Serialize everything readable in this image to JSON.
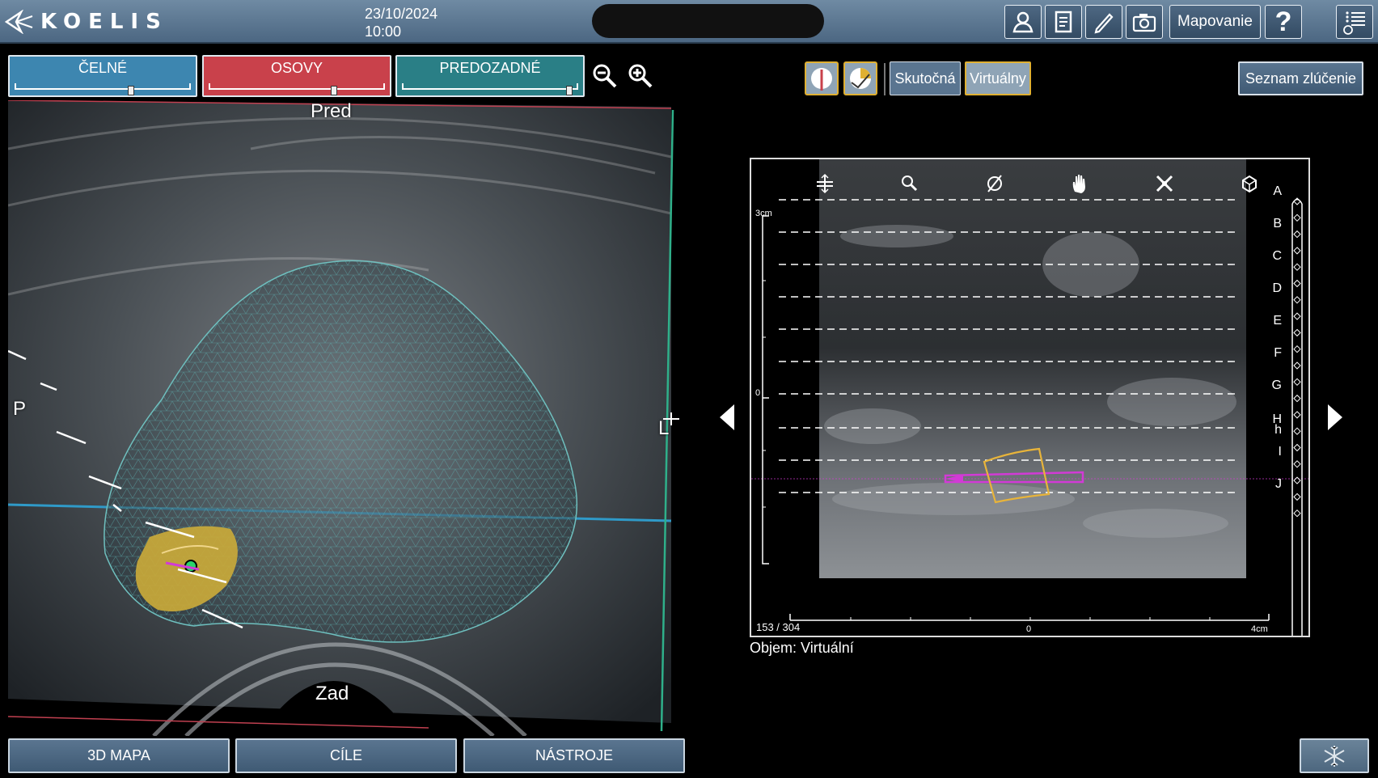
{
  "header": {
    "brand": "KOELIS",
    "date": "23/10/2024",
    "time": "10:00",
    "mapping_label": "Mapovanie",
    "help_label": "?"
  },
  "planes": {
    "frontal": {
      "label": "ČELNÉ",
      "color": "#3d86b0",
      "slider_fraction": 0.66
    },
    "axial": {
      "label": "OSOVY",
      "color": "#c9414b",
      "slider_fraction": 0.71
    },
    "sagittal": {
      "label": "PREDOZADNÉ",
      "color": "#2a7f86",
      "slider_fraction": 0.95
    }
  },
  "viewport3d": {
    "anterior_label": "Pred",
    "posterior_label": "Zad",
    "left_label": "P",
    "right_label": "L"
  },
  "right_panel": {
    "real_label": "Skutočná",
    "virtual_label": "Virtuálny",
    "merge_list_label": "Seznam zlúčenie"
  },
  "view2d": {
    "rows": [
      "A",
      "B",
      "C",
      "D",
      "E",
      "F",
      "G",
      "H",
      "h",
      "I",
      "J"
    ],
    "scale_top_label": "3cm",
    "scale_zero_left": "0",
    "frame_counter": "153 / 304",
    "x_zero_label": "0",
    "x_end_label": "4cm"
  },
  "volume_caption": "Objem: Virtuální",
  "bottom_nav": {
    "map3d": "3D MAPA",
    "targets": "CÍLE",
    "tools": "NÁSTROJE"
  },
  "colors": {
    "topbar": "#5a7590",
    "accent_yellow": "#e0b032",
    "needle_magenta": "#d23ad6",
    "target_yellow": "#e8b43a",
    "mesh_teal": "#4fb3b3"
  }
}
